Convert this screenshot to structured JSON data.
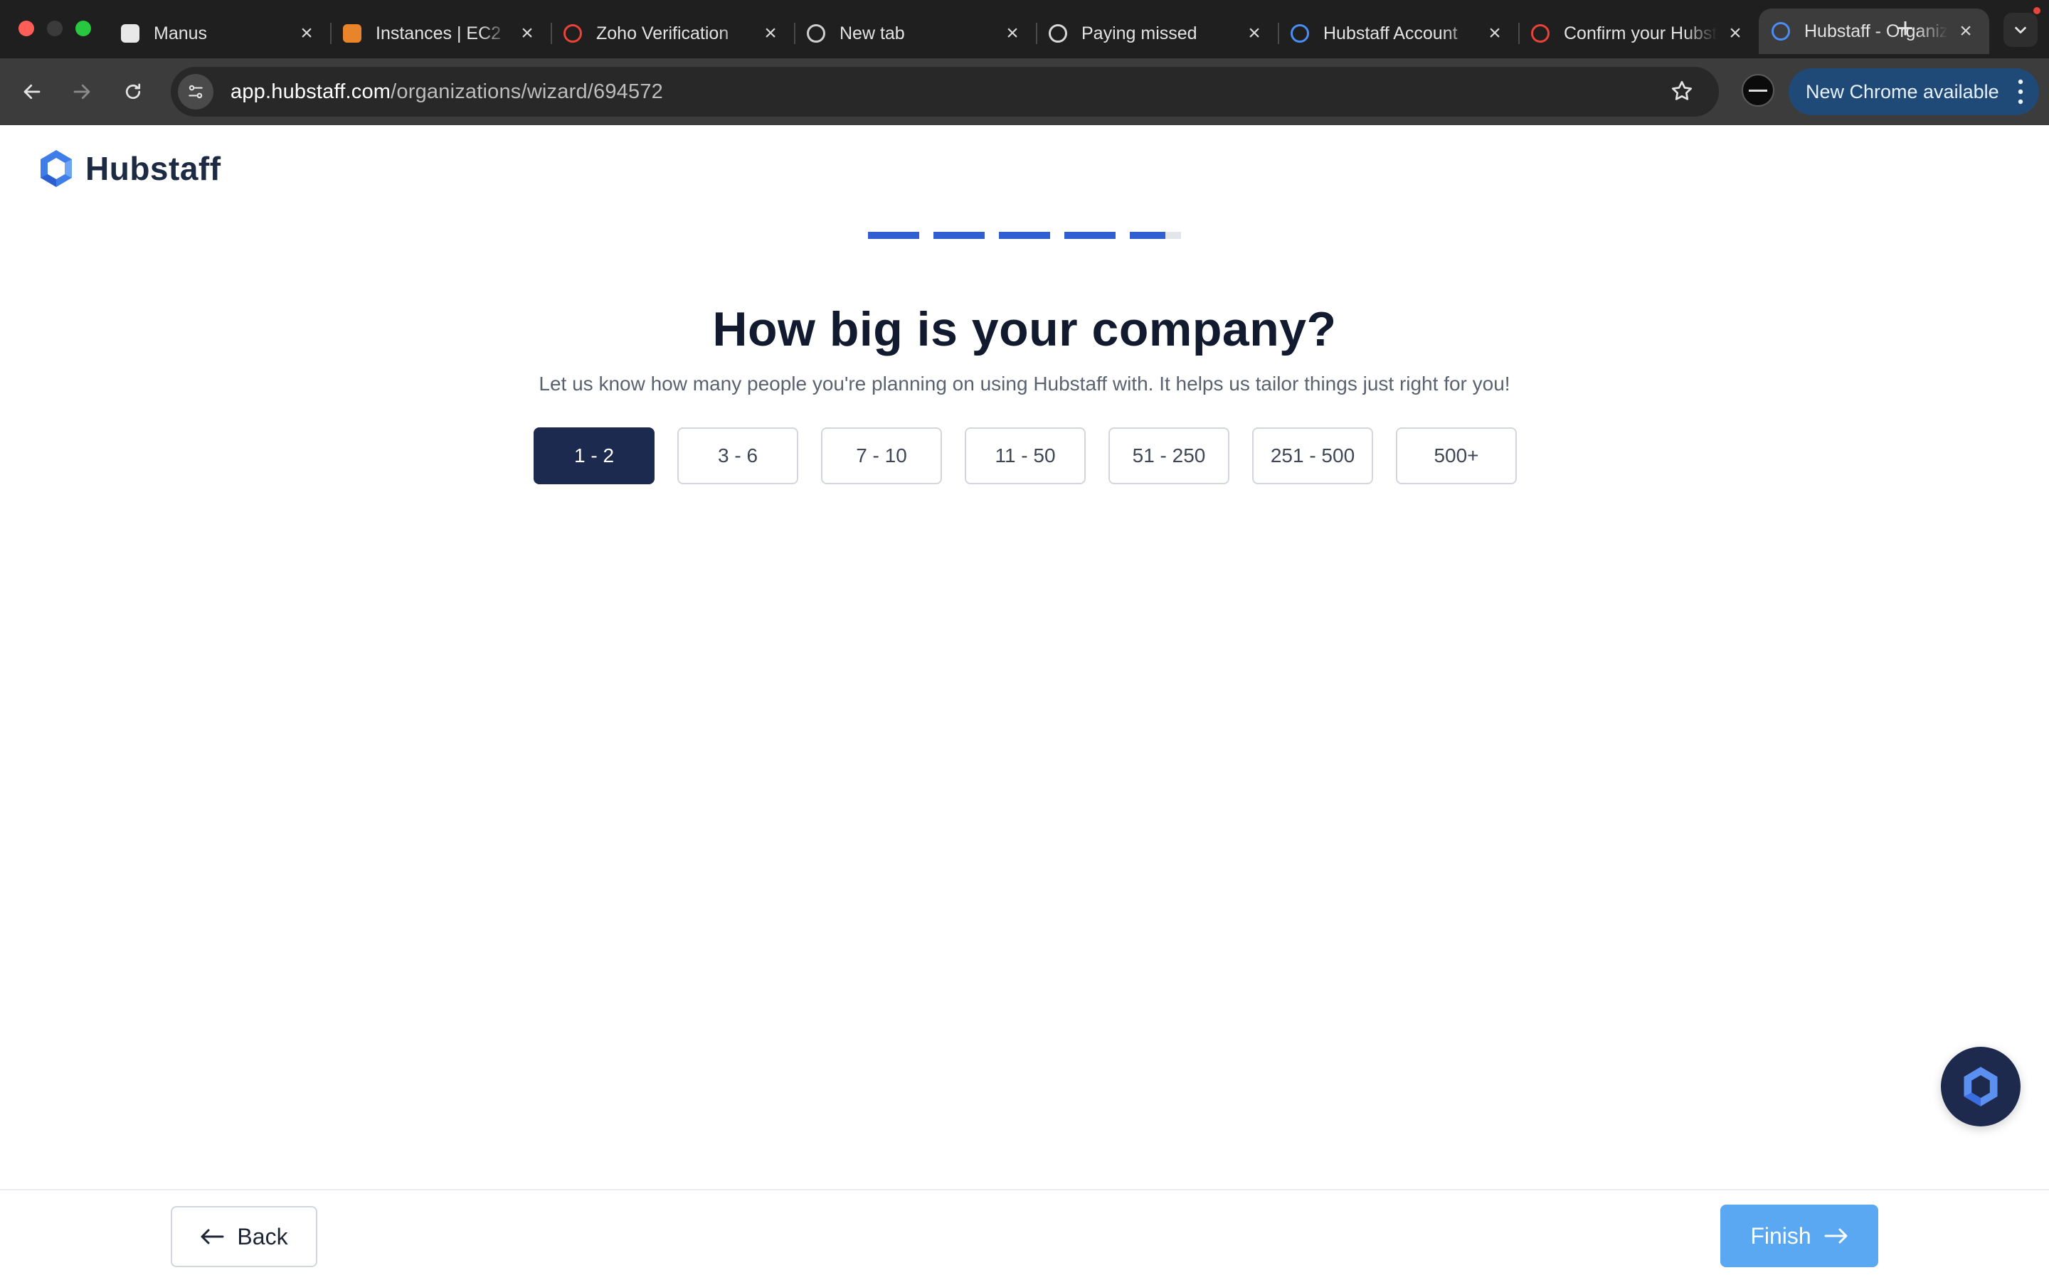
{
  "browser": {
    "tabs": [
      {
        "title": "Manus",
        "icon": "manus-icon",
        "icon_bg": "#e8e8e8",
        "icon_fg": "#222222",
        "active": false
      },
      {
        "title": "Instances | EC2",
        "icon": "aws-ec2-icon",
        "icon_bg": "#e8852b",
        "icon_fg": "#ffffff",
        "active": false
      },
      {
        "title": "Zoho Verification",
        "icon": "gmail-icon",
        "icon_bg": "transparent",
        "icon_fg": "#ea4335",
        "active": false
      },
      {
        "title": "New tab",
        "icon": "chrome-icon",
        "icon_bg": "transparent",
        "icon_fg": "#cfcfcf",
        "active": false
      },
      {
        "title": "Paying missed",
        "icon": "openai-icon",
        "icon_bg": "transparent",
        "icon_fg": "#d8d8d8",
        "active": false
      },
      {
        "title": "Hubstaff Account",
        "icon": "hubstaff-icon",
        "icon_bg": "transparent",
        "icon_fg": "#4a8df5",
        "active": false
      },
      {
        "title": "Confirm your Hubstaff",
        "icon": "gmail-icon",
        "icon_bg": "transparent",
        "icon_fg": "#ea4335",
        "active": false
      },
      {
        "title": "Hubstaff - Organization",
        "icon": "hubstaff-icon",
        "icon_bg": "transparent",
        "icon_fg": "#4a8df5",
        "active": true
      }
    ],
    "url_host": "app.hubstaff.com",
    "url_path": "/organizations/wizard/694572",
    "update_label": "New Chrome available"
  },
  "brand": {
    "name": "Hubstaff"
  },
  "wizard": {
    "progress": [
      1,
      1,
      1,
      1,
      0.7
    ],
    "heading": "How big is your company?",
    "subheading": "Let us know how many people you're planning on using Hubstaff with. It helps us tailor things just right for you!",
    "options": [
      {
        "label": "1 - 2",
        "selected": true
      },
      {
        "label": "3 - 6",
        "selected": false
      },
      {
        "label": "7 - 10",
        "selected": false
      },
      {
        "label": "11 - 50",
        "selected": false
      },
      {
        "label": "51 - 250",
        "selected": false
      },
      {
        "label": "251 - 500",
        "selected": false
      },
      {
        "label": "500+",
        "selected": false
      }
    ],
    "back_label": "Back",
    "finish_label": "Finish"
  },
  "colors": {
    "selected_option": "#1c2a4f",
    "progress_fill": "#2f5fd0",
    "finish_button": "#5aa8f2",
    "brand_blue": "#3f7ee8"
  }
}
